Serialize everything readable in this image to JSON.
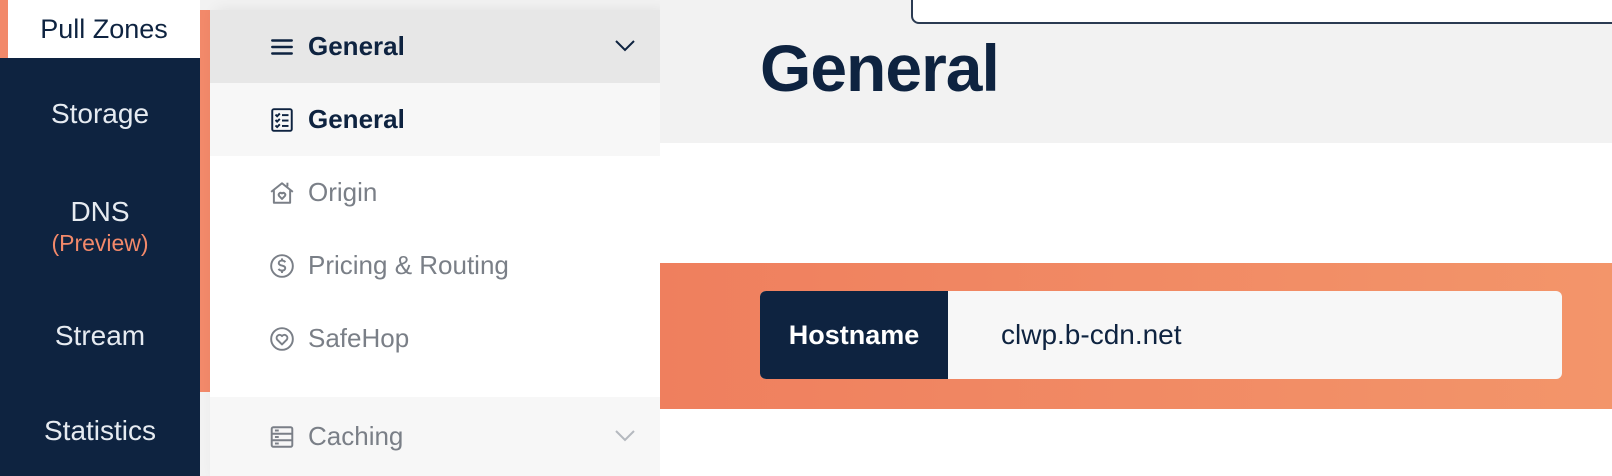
{
  "nav": {
    "top_item": "Pull Zones",
    "items": [
      {
        "label": "Storage"
      },
      {
        "label": "DNS",
        "sub": "(Preview)"
      },
      {
        "label": "Stream"
      },
      {
        "label": "Statistics"
      }
    ]
  },
  "submenu": {
    "header": "General",
    "items": [
      {
        "label": "General",
        "icon": "checklist-icon",
        "active": true
      },
      {
        "label": "Origin",
        "icon": "house-heart-icon"
      },
      {
        "label": "Pricing & Routing",
        "icon": "dollar-circle-icon"
      },
      {
        "label": "SafeHop",
        "icon": "heart-circle-icon"
      }
    ],
    "caching": "Caching"
  },
  "main": {
    "title": "General",
    "hostname_label": "Hostname",
    "hostname_value": "clwp.b-cdn.net"
  },
  "colors": {
    "navy": "#0e2340",
    "accent": "#f2896a"
  }
}
